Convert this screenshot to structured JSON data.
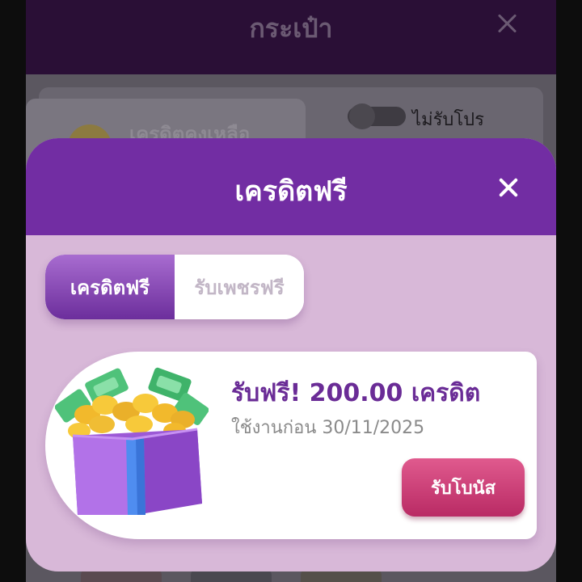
{
  "wallet": {
    "title": "กระเป๋า",
    "balance_label": "เครดิตคงเหลือ",
    "promo_toggle_label": "ไม่รับโปร",
    "promo_toggle_on": false
  },
  "modal": {
    "title": "เครดิตฟรี",
    "tabs": [
      {
        "label": "เครดิตฟรี",
        "active": true
      },
      {
        "label": "รับเพชรฟรี",
        "active": false
      }
    ],
    "bonus": {
      "title": "รับฟรี! 200.00 เครดิต",
      "expiry": "ใช้งานก่อน 30/11/2025",
      "claim_label": "รับโบนัส",
      "icon": "gift-box-with-coins-icon"
    }
  },
  "colors": {
    "header_purple": "#722da3",
    "modal_bg": "#d8b8d8",
    "title_purple": "#6a2c96",
    "claim_pink": "#c8396f"
  }
}
